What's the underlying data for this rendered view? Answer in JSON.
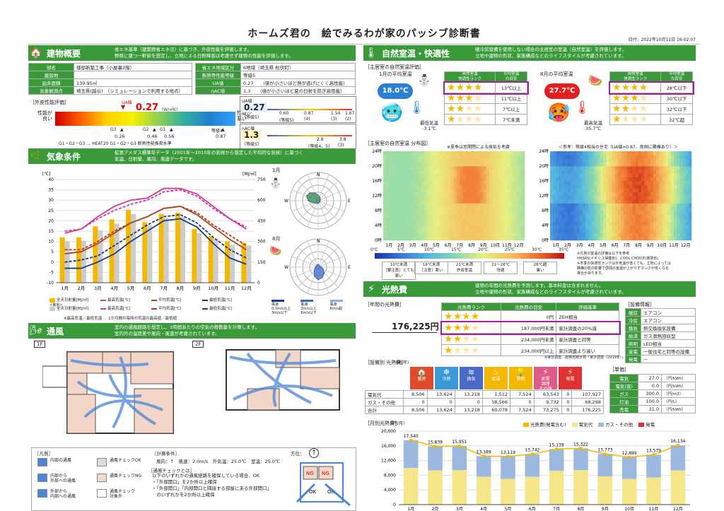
{
  "header": {
    "title": "ホームズ君の　絵でみるわが家のパッシブ診断書",
    "date": "日付：2022年10月11日 16:02:07"
  },
  "building": {
    "heading": "建物概要",
    "desc": "省エネ基準（建築物省エネ法）に基づき、外皮性能を評価します。\n野原に建つ一軒家を想定し、立地による日照障害は考慮せず建物の性能を評価します。",
    "rows_left": [
      [
        "邸名",
        "様邸新築工事（小屋裏2階）"
      ],
      [
        "建設地",
        ""
      ],
      [
        "延床面積",
        "139.95㎡"
      ],
      [
        "気象観測点",
        "埼玉県(越谷)　（シミュレーションで利用する地点）"
      ]
    ],
    "rows_right": [
      [
        "省エネ地域区分",
        "6地域（埼玉県 松伏町）"
      ],
      [
        "断熱等性能等級",
        "等級5"
      ],
      [
        "UA値",
        "0.27　　（値が小さいほど熱が逃げにくく高性能）"
      ],
      [
        "ηAC値",
        "1.3　　（値が小さいほど夏の日射を防ぎ高性能）"
      ]
    ],
    "eval_label": "［外皮性能評価］",
    "good": "性能が\n良い",
    "bad": "性能が\n悪い",
    "ua_label": "UA値",
    "ua_value": "0.27",
    "ua_unit": "（W/㎡K）",
    "g_ticks": [
      [
        "G3",
        "0.26"
      ],
      [
        "G2",
        "0.46"
      ],
      [
        "G1",
        "0.56"
      ],
      [
        "等級4",
        "0.87"
      ]
    ],
    "heat20_note": "G1・G2・G3 … HEAT20 G1・G2・G3 断熱性能推奨水準",
    "ua_box": {
      "title": "UA値",
      "value": "0.27",
      "grade": "（等級5）",
      "scale": [
        "0.60",
        "0.87",
        "1.54",
        "1.67"
      ],
      "scale_grades": [
        "(等級5)",
        "(4)",
        "(3)",
        "(2)"
      ]
    },
    "eta_box": {
      "title": "ηAC値",
      "value": "1.3",
      "grade": "（等級5）",
      "scale": [
        "2.8",
        "3.8"
      ],
      "scale_grades": [
        "(等級4、5)",
        "(3)"
      ]
    }
  },
  "weather": {
    "heading": "気象条件",
    "desc": "拡張アメダス標準年データ（2001年〜2010年の気候から想定した平均的な気候）に基づく\n気温、日射量、風向、風速データです。",
    "y_left_unit": "[℃]",
    "y_right_unit": "[MJ/㎡]",
    "jan": "1月",
    "aug": "8月",
    "legend": [
      "全天日射量[MJ/㎡]",
      "最高気温[℃]",
      "平均気温[℃]",
      "最低気温[℃]",
      "全天日射量[MJ/㎡]",
      "最高気温[℃]",
      "平均気温[℃]",
      "最低気温[℃]"
    ],
    "legend_sub": "<東京>",
    "legend_note": "※最高気温／最低気温 … 1か月間の毎時の気温の最高値／最低値",
    "wind_legend": [
      "風速\n0.3m/s以上\n3m/s以下",
      "風速\n3m/s以上\n6m/s以下",
      "風速\n6m/s超"
    ]
  },
  "vent": {
    "heading": "通風",
    "desc": "室内の通風経路を想定し、1時間あたりの空気の移動量を計算します。\n室内外の温度差や風向・風速が考慮されています。",
    "floor1": "1F",
    "floor2": "2F",
    "legend_title": "［凡例］",
    "legend_items": [
      "内部の通風",
      "通風チェックOK",
      "内部から\n外部への通風",
      "通風チェックNG",
      "外部から\n内部への通風",
      "通風チェック\n対象外"
    ],
    "calc_title": "［計算条件］",
    "calc": "風向：↑　風速：2.0m/s　外気温：25.0℃　室温：25.0℃",
    "check_title": "［通風チェックとは］",
    "check": "以下のいずれかの通風経路を確保している場合、OK\n・「外部開口」を2か所以上確保\n・「外部開口」「内部開口と隣接する部屋にある外部開口」\n　のいずれかを2か所以上確保",
    "compass": "方位："
  },
  "comfort": {
    "heading": "自然室温・快適性",
    "desc": "暖冷房設備を使用しない場合の主居室の室温（自然室温）を評価します。\n立地や建物の形状、家族構成などのライフスタイルが考慮されています。",
    "sub": "［主居室の自然室温評価］",
    "jan_title": "1月の平均室温",
    "jan_temp": "18.0℃",
    "jan_min": "最低気温\n-3.1℃",
    "aug_title": "8月の平均室温",
    "aug_temp": "27.7℃",
    "aug_max": "最高気温\n35.7℃",
    "rank_head": [
      "自然室温\n快適性ランク",
      "平均室温\nの目安"
    ],
    "winter_rows": [
      "13℃以上",
      "11℃以上",
      "7℃以上",
      "7℃未満"
    ],
    "summer_rows": [
      "28℃以下",
      "30℃以下",
      "32℃以下",
      "32℃超"
    ],
    "dist_title": "［主居室の自然室温 分布図］",
    "dist_note1": "※夏季は窓開閉による換気を考慮",
    "dist_note2": "＜参考：等級4相当の住宅（UA値=0.87、南側に隣棟あり）＞",
    "hours": [
      "24時",
      "20時",
      "16時",
      "12時",
      "8時",
      "4時",
      "0時"
    ],
    "months": [
      "1月",
      "2月",
      "3月",
      "4月",
      "5月",
      "6月",
      "7月",
      "8月",
      "9月",
      "10月",
      "11月",
      "12月"
    ],
    "scale": [
      "0℃",
      "5℃",
      "10℃",
      "15℃",
      "20℃",
      "25℃",
      "30℃",
      "35℃"
    ],
    "scale_labels": [
      "10℃未満\n［要注意］とても寒い",
      "16℃未満\n［注意］寒い",
      "21℃未満\n許容室温",
      "21〜28℃\n快適",
      "28℃超\n暑い"
    ],
    "scale_note": "※凡例の室温の評価は以下を参考\nHHSRS(イギリス保健省)、COOL CHOICE(環境省)\n※冬季の快適性ランクは外気温が低くても、立地によっては\n隣棟の影の影響で昼間の室温が上がりずランクが低くなる\n場合があります。"
  },
  "energy": {
    "heading": "光熱費",
    "desc": "建物の年間の光熱費を予測します。基本料金は含まれません。\n立地や建物の形状、家族構成などのライフスタイルが考慮されています。",
    "annual_label": "［年間の光熱費］",
    "annual_value": "176,225円",
    "rank_head": [
      "光熱費ランク",
      "光熱費の目安",
      "評価基準"
    ],
    "rank_rows": [
      [
        "0円",
        "ZEH相当"
      ],
      [
        "187,000円未満",
        "家計調査の20%減"
      ],
      [
        "234,000円未満",
        "家計調査と同等"
      ],
      [
        "234,000円以上",
        "家計調査より高い"
      ]
    ],
    "rank_note": "※家計調査…総務省統計局「家計調査（2019年）」",
    "equip_title": "［設備情報］",
    "equip": [
      [
        "暖房",
        "エアコン"
      ],
      [
        "冷房",
        "エアコン"
      ],
      [
        "換気",
        "熱交換換気設備"
      ],
      [
        "給湯",
        "ガス潜熱回収型"
      ],
      [
        "照明",
        "LED相当"
      ],
      [
        "家電",
        "一般住宅と同等の設備"
      ],
      [
        "発電",
        "－"
      ]
    ],
    "by_equip_title": "［設備別 光熱費］",
    "by_equip_unit": "（円/年）",
    "cols": [
      "暖房",
      "冷房",
      "換気",
      "給湯",
      "照明",
      "家電\n調理\nその他",
      "発電",
      "合計"
    ],
    "rows": [
      [
        "電気代",
        "8,506",
        "13,624",
        "13,218",
        "1,512",
        "7,524",
        "63,543",
        "0",
        "107,927"
      ],
      [
        "ガス・その他",
        "0",
        "0",
        "0",
        "58,566",
        "0",
        "9,732",
        "0",
        "68,298"
      ],
      [
        "合計",
        "8,506",
        "13,624",
        "13,218",
        "60,078",
        "7,524",
        "73,275",
        "0",
        "176,225"
      ]
    ],
    "price_title": "［単価］",
    "prices": [
      [
        "電気",
        "27.0",
        "（円/kWh）"
      ],
      [
        "電気(夜)",
        "0.0",
        "（円/kWh）"
      ],
      [
        "ガス",
        "300.0",
        "（円/m3）"
      ],
      [
        "灯油",
        "100.0",
        "（円/L）"
      ],
      [
        "売電",
        "31.0",
        "（円/kWh）"
      ]
    ],
    "monthly_title": "［月別光熱費］",
    "monthly_unit": "（円/月）",
    "legend": [
      "光熱費(発電含む)",
      "電気代",
      "ガス・その他",
      "発電"
    ]
  },
  "chart_data": [
    {
      "type": "bar+line",
      "title": "気象条件",
      "categories": [
        "1月",
        "2月",
        "3月",
        "4月",
        "5月",
        "6月",
        "7月",
        "8月",
        "9月",
        "10月",
        "11月",
        "12月"
      ],
      "ylim_left": [
        -10,
        40
      ],
      "ylim_right": [
        0,
        750
      ],
      "series": [
        {
          "name": "全天日射量[MJ/㎡]",
          "axis": "right",
          "values": [
            330,
            330,
            410,
            460,
            530,
            440,
            500,
            510,
            390,
            340,
            300,
            290
          ]
        },
        {
          "name": "全天日射量[MJ/㎡]<東京>",
          "axis": "right",
          "values": [
            300,
            305,
            380,
            430,
            500,
            420,
            470,
            480,
            360,
            320,
            275,
            270
          ]
        },
        {
          "name": "最高気温[℃]",
          "values": [
            14,
            16,
            22,
            27,
            30,
            31,
            35.7,
            35.7,
            33,
            27,
            21,
            16
          ]
        },
        {
          "name": "平均気温[℃]",
          "values": [
            4,
            5,
            9,
            14,
            19,
            22,
            26,
            27,
            23,
            17,
            11,
            6
          ]
        },
        {
          "name": "最低気温[℃]",
          "values": [
            -3,
            -3,
            0,
            4,
            10,
            15,
            20,
            21,
            17,
            9,
            2,
            -1
          ]
        },
        {
          "name": "最高気温[℃]<東京>",
          "values": [
            15,
            16,
            21,
            25,
            28,
            30,
            34,
            35,
            32,
            26,
            21,
            17
          ]
        },
        {
          "name": "平均気温[℃]<東京>",
          "values": [
            6,
            6,
            10,
            15,
            19,
            22,
            26,
            27,
            24,
            18,
            13,
            8
          ]
        },
        {
          "name": "最低気温[℃]<東京>",
          "values": [
            0,
            1,
            3,
            8,
            13,
            18,
            22,
            23,
            19,
            12,
            6,
            2
          ]
        }
      ],
      "yticks_left": [
        "40",
        "35",
        "30",
        "25",
        "20",
        "15",
        "10",
        "5",
        "0",
        "-5",
        "-10"
      ],
      "yticks_right": [
        "750",
        "600",
        "450",
        "300",
        "150",
        "0"
      ]
    },
    {
      "type": "bar",
      "title": "月別光熱費",
      "categories": [
        "1月",
        "2月",
        "3月",
        "4月",
        "5月",
        "6月",
        "7月",
        "8月",
        "9月",
        "10月",
        "11月",
        "12月"
      ],
      "ylim": [
        0,
        20000
      ],
      "yticks": [
        "20,000",
        "16,000",
        "12,000",
        "8,000",
        "4,000",
        "0"
      ],
      "series": [
        {
          "name": "光熱費(発電含む)",
          "values": [
            17540,
            15839,
            15951,
            13189,
            13119,
            13742,
            15139,
            15322,
            13773,
            12899,
            13579,
            16134
          ]
        },
        {
          "name": "電気代",
          "values": [
            10000,
            9300,
            9400,
            7600,
            7000,
            7600,
            9200,
            9400,
            7700,
            7000,
            7400,
            9300
          ]
        },
        {
          "name": "ガス・その他",
          "values": [
            7540,
            6539,
            6551,
            5589,
            6119,
            6142,
            5939,
            5922,
            6073,
            5899,
            6179,
            6834
          ]
        },
        {
          "name": "発電",
          "values": [
            0,
            0,
            0,
            0,
            0,
            0,
            0,
            0,
            0,
            0,
            0,
            0
          ]
        }
      ],
      "labels": [
        "17,540",
        "15,839",
        "15,951",
        "13,189",
        "13,119",
        "13,742",
        "15,139",
        "15,322",
        "13,773",
        "12,899",
        "13,579",
        "16,134"
      ]
    }
  ]
}
